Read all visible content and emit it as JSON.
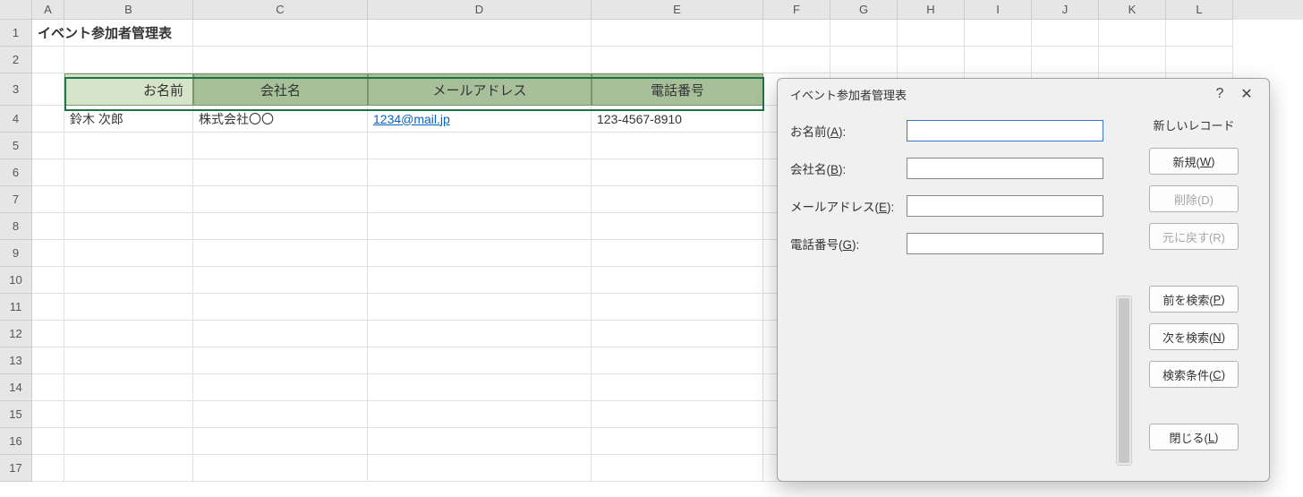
{
  "columns": [
    "A",
    "B",
    "C",
    "D",
    "E",
    "F",
    "G",
    "H",
    "I",
    "J",
    "K",
    "L"
  ],
  "row_count": 17,
  "title": "イベント参加者管理表",
  "table_headers": {
    "name": "お名前",
    "company": "会社名",
    "email": "メールアドレス",
    "phone": "電話番号"
  },
  "data_row": {
    "name": "鈴木 次郎",
    "company": "株式会社〇〇",
    "email": "1234@mail.jp",
    "phone": "123-4567-8910"
  },
  "dialog": {
    "title": "イベント参加者管理表",
    "help_symbol": "?",
    "close_symbol": "✕",
    "record_status": "新しいレコード",
    "fields": {
      "name": {
        "label": "お名前(A):",
        "underline": "A",
        "value": ""
      },
      "company": {
        "label": "会社名(B):",
        "underline": "B",
        "value": ""
      },
      "email": {
        "label": "メールアドレス(E):",
        "underline": "E",
        "value": ""
      },
      "phone": {
        "label": "電話番号(G):",
        "underline": "G",
        "value": ""
      }
    },
    "buttons": {
      "new": "新規(W)",
      "delete": "削除(D)",
      "restore": "元に戻す(R)",
      "find_prev": "前を検索(P)",
      "find_next": "次を検索(N)",
      "criteria": "検索条件(C)",
      "close": "閉じる(L)"
    }
  }
}
